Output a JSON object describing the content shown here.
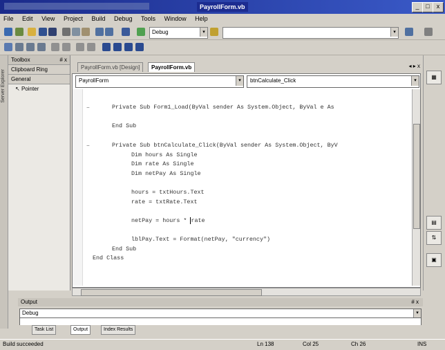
{
  "window": {
    "title_selected": "PayrollForm.vb",
    "minimize": "_",
    "close": "x"
  },
  "menu": [
    "File",
    "Edit",
    "View",
    "Project",
    "Build",
    "Debug",
    "Tools",
    "Window",
    "Help"
  ],
  "toolbar": {
    "config_combo": "Debug",
    "config_arrow": "▾"
  },
  "toolbox": {
    "title": "Toolbox",
    "pin": "# x",
    "tab1": "Clipboard Ring",
    "tab2": "General",
    "pointer": "Pointer",
    "side_label": "Server Explorer"
  },
  "tabs": {
    "design": "PayrollForm.vb [Design]",
    "code": "PayrollForm.vb"
  },
  "editor": {
    "class_combo": "PayrollForm",
    "method_combo": "btnCalculate_Click",
    "lines": [
      "Private Sub Form1_Load(ByVal sender As System.Object, ByVal e As",
      "End Sub",
      "Private Sub btnCalculate_Click(ByVal sender As System.Object, ByV",
      "Dim hours As Single",
      "Dim rate As Single",
      "Dim netPay As Single",
      "hours = txtHours.Text",
      "rate = txtRate.Text",
      "netPay = hours * ",
      "rate",
      "lblPay.Text = Format(netPay, \"currency\")",
      "End Sub",
      "End Class"
    ]
  },
  "output": {
    "title": "Output",
    "pin": "# x",
    "combo": "Debug",
    "tabs": [
      "Task List",
      "Output",
      "Index Results"
    ]
  },
  "statusbar": {
    "message": "Build succeeded",
    "ln": "Ln 138",
    "col": "Col 25",
    "ch": "Ch 26",
    "mode": "INS"
  },
  "colors": {
    "titlebar": "#1a2a8a",
    "chrome": "#d4d0c8",
    "editor_bg": "#ffffff"
  }
}
